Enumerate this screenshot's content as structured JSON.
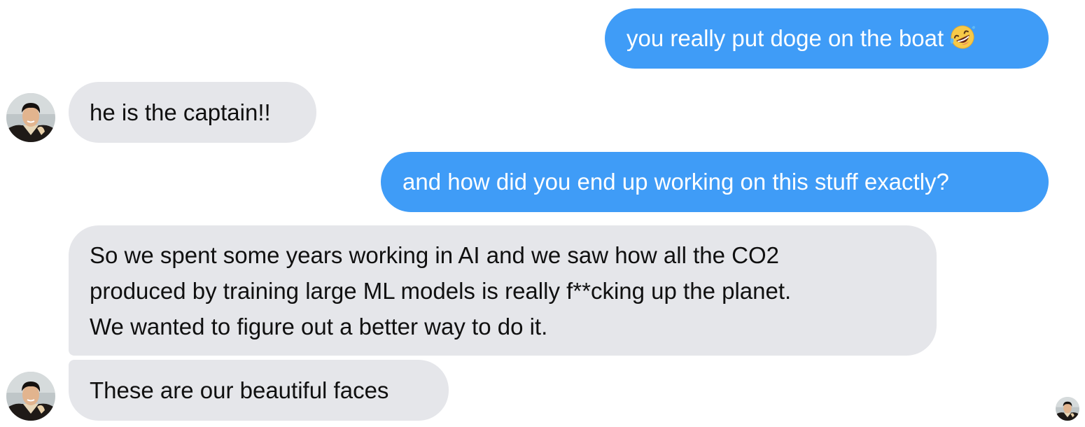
{
  "messages": [
    {
      "sender": "me",
      "text": "you really put doge on the boat",
      "emoji": "rolling-on-floor-laughing"
    },
    {
      "sender": "them",
      "text": "he is the captain!!"
    },
    {
      "sender": "me",
      "text": "and how did you end up working on this stuff exactly?"
    },
    {
      "sender": "them",
      "lines": [
        "So we spent some years working in AI and we saw how all the CO2",
        "produced by training large ML models is really f**cking up the planet.",
        "We wanted to figure out a better way to do it."
      ]
    },
    {
      "sender": "them",
      "text": "These are our beautiful faces"
    }
  ],
  "colors": {
    "outgoing_bubble": "#3f9cf7",
    "incoming_bubble": "#e5e6ea",
    "background": "#ffffff"
  },
  "icons": {
    "emoji": "rolling-on-floor-laughing-icon",
    "avatar": "contact-avatar",
    "read_receipt": "read-receipt-avatar"
  }
}
